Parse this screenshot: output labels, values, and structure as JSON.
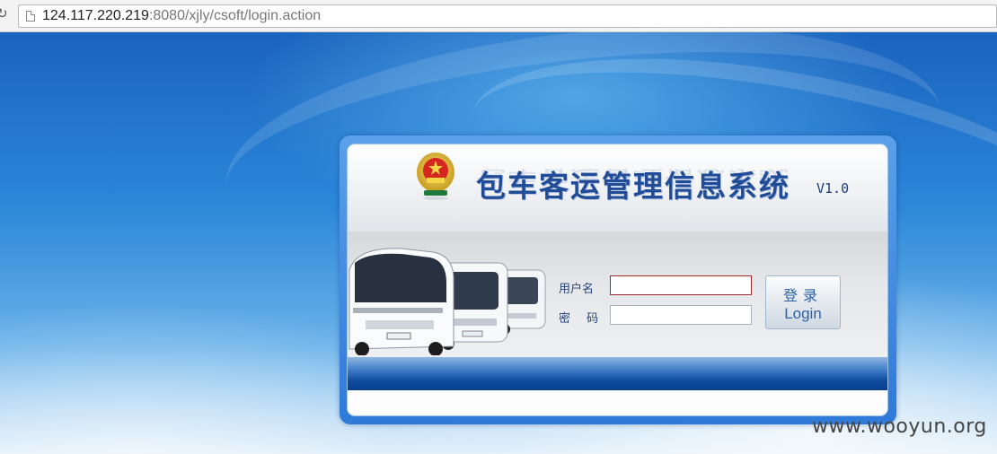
{
  "browser": {
    "url_host": "124.117.220.219",
    "url_path": ":8080/xjly/csoft/login.action",
    "icons": {
      "reload": "reload-icon",
      "page": "page-icon"
    }
  },
  "login": {
    "title": "包车客运管理信息系统",
    "version": "V1.0",
    "username_label": "用户名",
    "username_value": "",
    "password_label": "密  码",
    "password_value": "",
    "button_cn": "登录",
    "button_en": "Login",
    "emblem": "national-emblem-icon"
  },
  "watermark": "www.wooyun.org",
  "colors": {
    "title": "#214d98",
    "label": "#26457a",
    "button_text": "#2a62a8",
    "focus_border": "#9c2b2b",
    "stripe_dark": "#0a3f8c"
  }
}
